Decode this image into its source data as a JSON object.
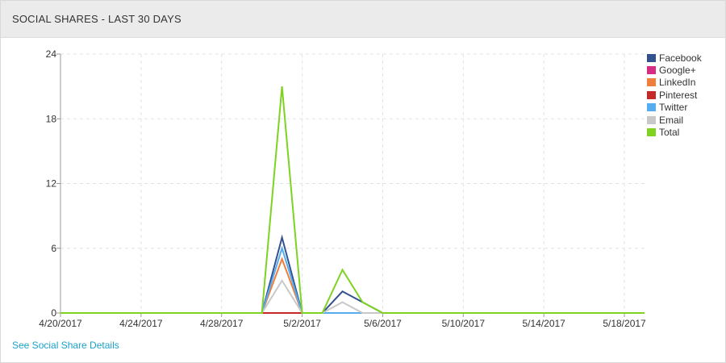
{
  "panel": {
    "title": "SOCIAL SHARES - LAST 30 DAYS",
    "link_label": "See Social Share Details",
    "link_color": "#1ba1c9"
  },
  "chart_data": {
    "type": "line",
    "xlabel": "",
    "ylabel": "",
    "x": [
      "4/20/2017",
      "4/21/2017",
      "4/22/2017",
      "4/23/2017",
      "4/24/2017",
      "4/25/2017",
      "4/26/2017",
      "4/27/2017",
      "4/28/2017",
      "4/29/2017",
      "4/30/2017",
      "5/1/2017",
      "5/2/2017",
      "5/3/2017",
      "5/4/2017",
      "5/5/2017",
      "5/6/2017",
      "5/7/2017",
      "5/8/2017",
      "5/9/2017",
      "5/10/2017",
      "5/11/2017",
      "5/12/2017",
      "5/13/2017",
      "5/14/2017",
      "5/15/2017",
      "5/16/2017",
      "5/17/2017",
      "5/18/2017",
      "5/19/2017"
    ],
    "x_tick_labels": [
      "4/20/2017",
      "4/24/2017",
      "4/28/2017",
      "5/2/2017",
      "5/6/2017",
      "5/10/2017",
      "5/14/2017",
      "5/18/2017"
    ],
    "y_ticks": [
      "0",
      "6",
      "12",
      "18",
      "24"
    ],
    "ylim": [
      0,
      24
    ],
    "grid": true,
    "legend_position": "top-right",
    "series": [
      {
        "name": "Facebook",
        "color": "#34518f",
        "values": [
          0,
          0,
          0,
          0,
          0,
          0,
          0,
          0,
          0,
          0,
          0,
          7,
          0,
          0,
          2,
          1,
          0,
          0,
          0,
          0,
          0,
          0,
          0,
          0,
          0,
          0,
          0,
          0,
          0,
          0
        ]
      },
      {
        "name": "Google+",
        "color": "#d62c84",
        "values": [
          0,
          0,
          0,
          0,
          0,
          0,
          0,
          0,
          0,
          0,
          0,
          0,
          0,
          0,
          0,
          0,
          0,
          0,
          0,
          0,
          0,
          0,
          0,
          0,
          0,
          0,
          0,
          0,
          0,
          0
        ]
      },
      {
        "name": "LinkedIn",
        "color": "#f07f3c",
        "values": [
          0,
          0,
          0,
          0,
          0,
          0,
          0,
          0,
          0,
          0,
          0,
          5,
          0,
          0,
          0,
          0,
          0,
          0,
          0,
          0,
          0,
          0,
          0,
          0,
          0,
          0,
          0,
          0,
          0,
          0
        ]
      },
      {
        "name": "Pinterest",
        "color": "#c62828",
        "values": [
          0,
          0,
          0,
          0,
          0,
          0,
          0,
          0,
          0,
          0,
          0,
          0,
          0,
          0,
          0,
          0,
          0,
          0,
          0,
          0,
          0,
          0,
          0,
          0,
          0,
          0,
          0,
          0,
          0,
          0
        ]
      },
      {
        "name": "Twitter",
        "color": "#55acee",
        "values": [
          0,
          0,
          0,
          0,
          0,
          0,
          0,
          0,
          0,
          0,
          0,
          6,
          0,
          0,
          0,
          0,
          0,
          0,
          0,
          0,
          0,
          0,
          0,
          0,
          0,
          0,
          0,
          0,
          0,
          0
        ]
      },
      {
        "name": "Email",
        "color": "#c8c8c8",
        "values": [
          0,
          0,
          0,
          0,
          0,
          0,
          0,
          0,
          0,
          0,
          0,
          3,
          0,
          0,
          1,
          0,
          0,
          0,
          0,
          0,
          0,
          0,
          0,
          0,
          0,
          0,
          0,
          0,
          0,
          0
        ]
      },
      {
        "name": "Total",
        "color": "#7ed321",
        "values": [
          0,
          0,
          0,
          0,
          0,
          0,
          0,
          0,
          0,
          0,
          0,
          21,
          0,
          0,
          4,
          1,
          0,
          0,
          0,
          0,
          0,
          0,
          0,
          0,
          0,
          0,
          0,
          0,
          0,
          0
        ]
      }
    ]
  }
}
